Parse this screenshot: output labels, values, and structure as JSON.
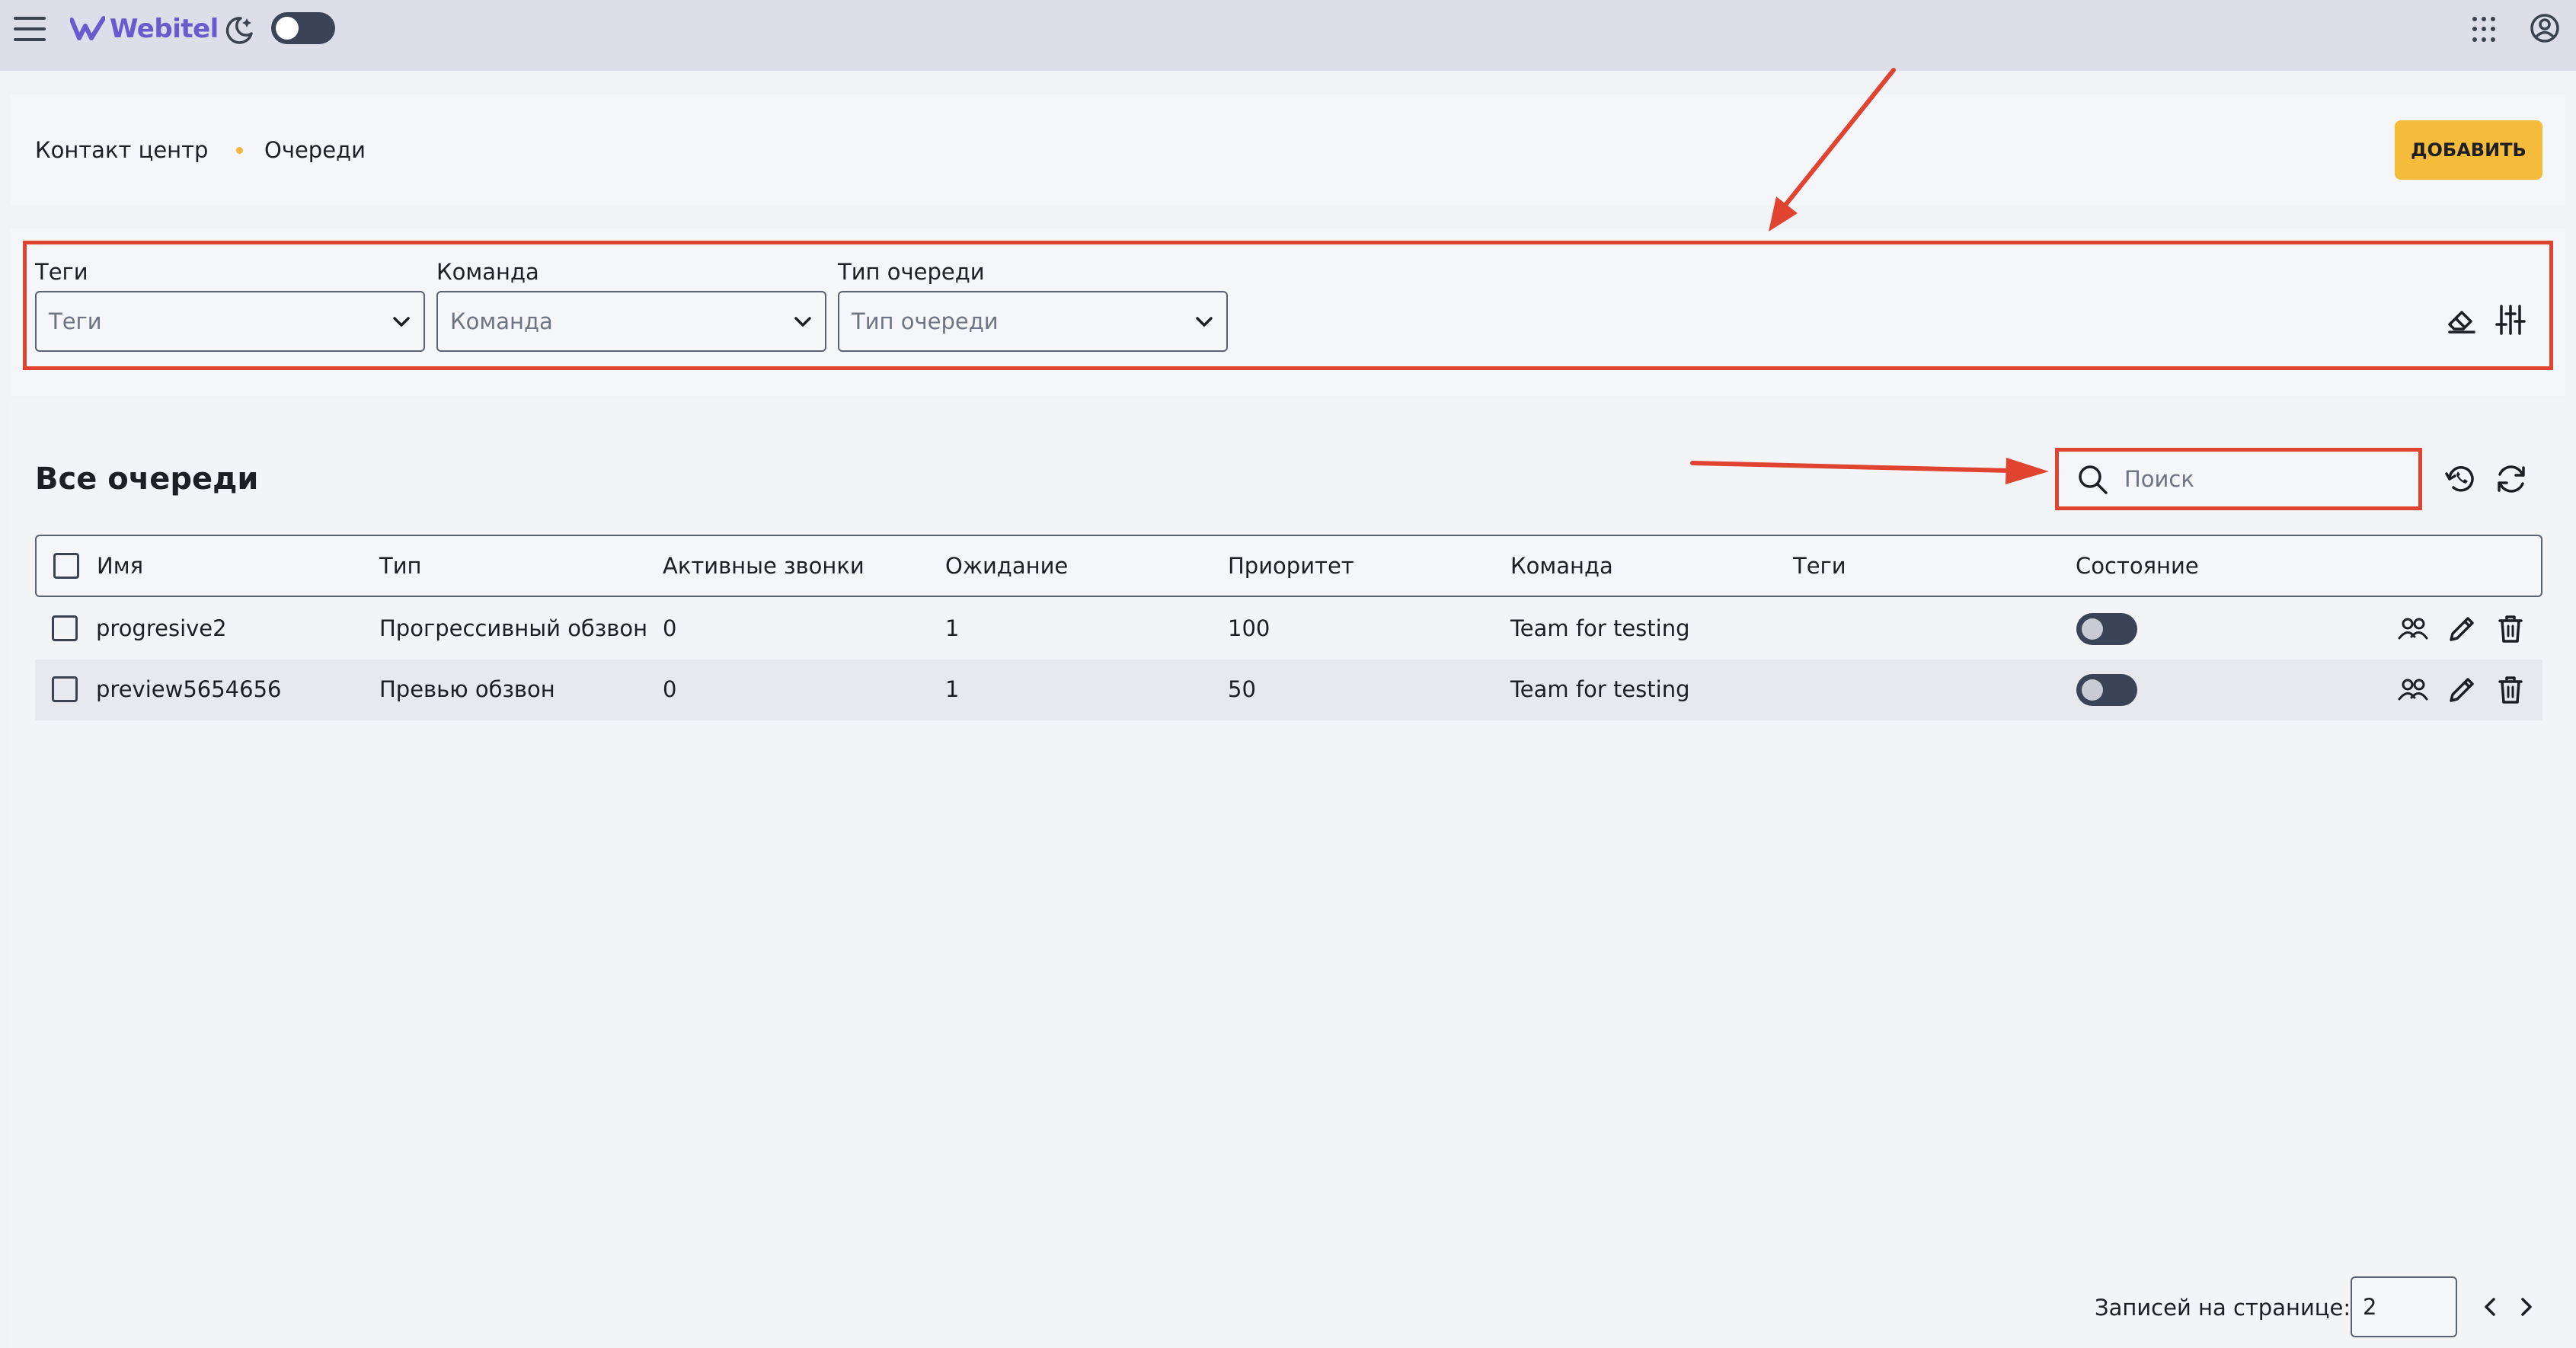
{
  "app": {
    "logo_text": "Webitel",
    "icons": {
      "menu": "hamburger-menu-icon",
      "theme": "moon-icon",
      "apps": "apps-grid-icon",
      "account": "account-icon"
    }
  },
  "header": {
    "breadcrumb": [
      "Контакт центр",
      "Очереди"
    ],
    "add_button": "ДОБАВИТЬ"
  },
  "filters": [
    {
      "label": "Теги",
      "placeholder": "Теги"
    },
    {
      "label": "Команда",
      "placeholder": "Команда"
    },
    {
      "label": "Тип очереди",
      "placeholder": "Тип очереди"
    }
  ],
  "table": {
    "title": "Все очереди",
    "search_placeholder": "Поиск",
    "columns": [
      "Имя",
      "Тип",
      "Активные звонки",
      "Ожидание",
      "Приоритет",
      "Команда",
      "Теги",
      "Состояние"
    ],
    "rows": [
      {
        "name": "progresive2",
        "type": "Прогрессивный обзвон",
        "active_calls": "0",
        "waiting": "1",
        "priority": "100",
        "team": "Team for testing",
        "tags": "",
        "enabled": false
      },
      {
        "name": "preview5654656",
        "type": "Превью обзвон",
        "active_calls": "0",
        "waiting": "1",
        "priority": "50",
        "team": "Team for testing",
        "tags": "",
        "enabled": false
      }
    ]
  },
  "pagination": {
    "label": "Записей на странице:",
    "per_page": "2"
  },
  "colors": {
    "accent": "#f5bb3b",
    "annotation": "#e0432f",
    "topbar": "#dcdee9"
  }
}
